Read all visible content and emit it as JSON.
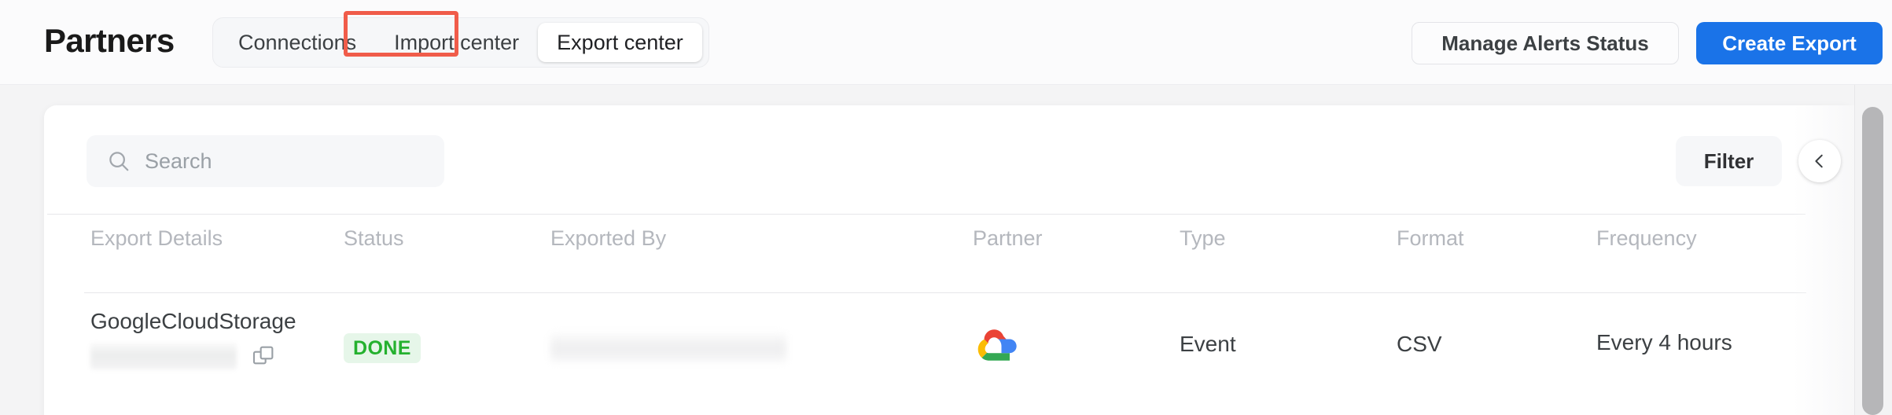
{
  "header": {
    "title": "Partners",
    "tabs": [
      {
        "label": "Connections",
        "active": false
      },
      {
        "label": "Import center",
        "active": false
      },
      {
        "label": "Export center",
        "active": true
      }
    ],
    "manage_alerts_label": "Manage Alerts Status",
    "create_export_label": "Create Export",
    "highlight_color": "#f05c4a",
    "primary_button_color": "#1a73e8"
  },
  "toolbar": {
    "search": {
      "icon": "search-icon",
      "value": "",
      "placeholder": "Search"
    },
    "filter_label": "Filter",
    "collapse_icon": "chevron-left-icon"
  },
  "table": {
    "columns": [
      "Export Details",
      "Status",
      "Exported By",
      "Partner",
      "Type",
      "Format",
      "Frequency"
    ],
    "rows": [
      {
        "export_details": {
          "name": "GoogleCloudStorage",
          "id": "",
          "id_redacted": true,
          "copy_icon": "copy-icon"
        },
        "status": "DONE",
        "status_color": "#25b12f",
        "status_background": "#e6f6e9",
        "exported_by": "",
        "exported_by_redacted": true,
        "partner_icon": "google-cloud-icon",
        "type": "Event",
        "format": "CSV",
        "frequency": "Every 4 hours"
      }
    ]
  },
  "scrollbar": {
    "orientation": "vertical",
    "thumb_color": "#b6b6b8"
  }
}
